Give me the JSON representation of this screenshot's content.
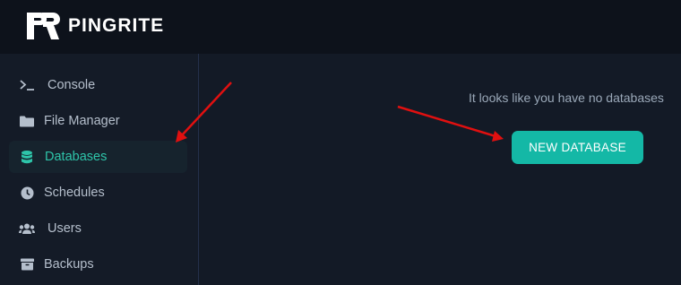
{
  "brand": {
    "name": "PINGRITE"
  },
  "sidebar": {
    "items": [
      {
        "label": "Console",
        "icon": "terminal-icon"
      },
      {
        "label": "File Manager",
        "icon": "folder-icon"
      },
      {
        "label": "Databases",
        "icon": "database-icon",
        "active": true
      },
      {
        "label": "Schedules",
        "icon": "clock-icon"
      },
      {
        "label": "Users",
        "icon": "users-icon"
      },
      {
        "label": "Backups",
        "icon": "archive-icon"
      }
    ]
  },
  "main": {
    "empty_message": "It looks like you have no databases",
    "new_database_label": "NEW DATABASE"
  },
  "colors": {
    "accent": "#14b8a6",
    "active_text": "#2ec4a9",
    "annotation_arrow": "#e01010",
    "background": "#131a26",
    "topbar": "#0d121b"
  }
}
